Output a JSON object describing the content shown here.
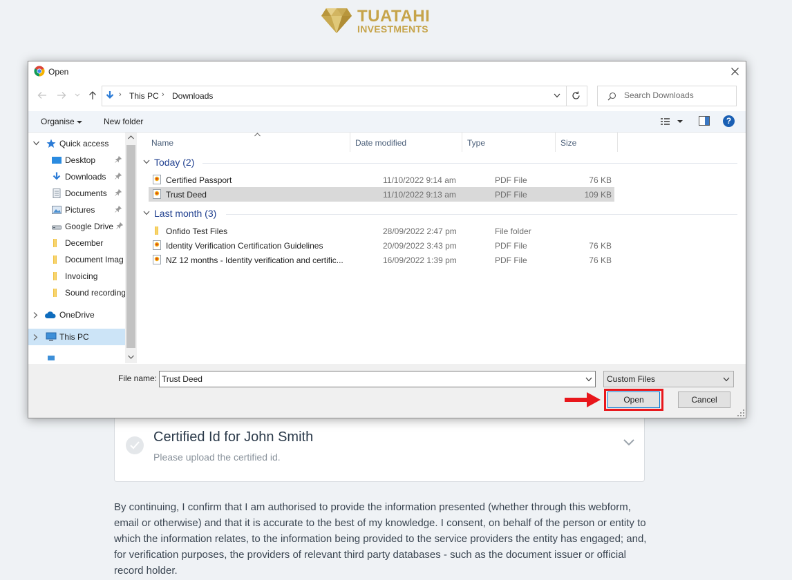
{
  "brand": {
    "name": "TUATAHI",
    "sub": "INVESTMENTS",
    "color": "#c6a44a"
  },
  "card": {
    "title": "Certified Id for John Smith",
    "description": "Please upload the certified id."
  },
  "consent_text": "By continuing, I confirm that I am authorised to provide the information presented (whether through this webform, email or otherwise) and that it is accurate to the best of my knowledge. I consent, on behalf of the person or entity to which the information relates, to the information being provided to the service providers the entity has engaged; and, for verification purposes, the providers of relevant third party databases - such as the document issuer or official record holder.",
  "dialog": {
    "title": "Open",
    "app_icon": "chrome-icon",
    "address": {
      "crumbs": [
        "This PC",
        "Downloads"
      ]
    },
    "search_placeholder": "Search Downloads",
    "toolbar": {
      "organise": "Organise",
      "new_folder": "New folder",
      "help": "?"
    },
    "nav": [
      {
        "label": "Quick access",
        "icon": "star-icon",
        "pinned": false
      },
      {
        "label": "Desktop",
        "icon": "desktop-icon",
        "pinned": true
      },
      {
        "label": "Downloads",
        "icon": "download-icon",
        "pinned": true
      },
      {
        "label": "Documents",
        "icon": "documents-icon",
        "pinned": true
      },
      {
        "label": "Pictures",
        "icon": "pictures-icon",
        "pinned": true
      },
      {
        "label": "Google Drive",
        "icon": "drive-icon",
        "pinned": true
      },
      {
        "label": "December",
        "icon": "folder-icon",
        "pinned": false
      },
      {
        "label": "Document Imag",
        "icon": "folder-icon",
        "pinned": false
      },
      {
        "label": "Invoicing",
        "icon": "folder-icon",
        "pinned": false
      },
      {
        "label": "Sound recording",
        "icon": "folder-icon",
        "pinned": false
      },
      {
        "label": "OneDrive",
        "icon": "cloud-icon",
        "pinned": false
      },
      {
        "label": "This PC",
        "icon": "pc-icon",
        "pinned": false
      }
    ],
    "columns": [
      "Name",
      "Date modified",
      "Type",
      "Size"
    ],
    "groups": [
      {
        "title": "Today (2)",
        "files": [
          {
            "name": "Certified Passport",
            "date": "11/10/2022 9:14 am",
            "type": "PDF File",
            "size": "76 KB",
            "icon": "pdf-file-icon"
          },
          {
            "name": "Trust Deed",
            "date": "11/10/2022 9:13 am",
            "type": "PDF File",
            "size": "109 KB",
            "icon": "pdf-file-icon",
            "selected": true
          }
        ]
      },
      {
        "title": "Last month (3)",
        "files": [
          {
            "name": "Onfido Test Files",
            "date": "28/09/2022 2:47 pm",
            "type": "File folder",
            "size": "",
            "icon": "folder-icon"
          },
          {
            "name": "Identity Verification Certification Guidelines",
            "date": "20/09/2022 3:43 pm",
            "type": "PDF File",
            "size": "76 KB",
            "icon": "pdf-file-icon"
          },
          {
            "name": "NZ 12 months - Identity verification and certific...",
            "date": "16/09/2022 1:39 pm",
            "type": "PDF File",
            "size": "76 KB",
            "icon": "pdf-file-icon"
          }
        ]
      }
    ],
    "file_name_label": "File name:",
    "file_name_value": "Trust Deed",
    "filter": "Custom Files",
    "open_label": "Open",
    "cancel_label": "Cancel",
    "highlight_color": "#e8161b"
  }
}
